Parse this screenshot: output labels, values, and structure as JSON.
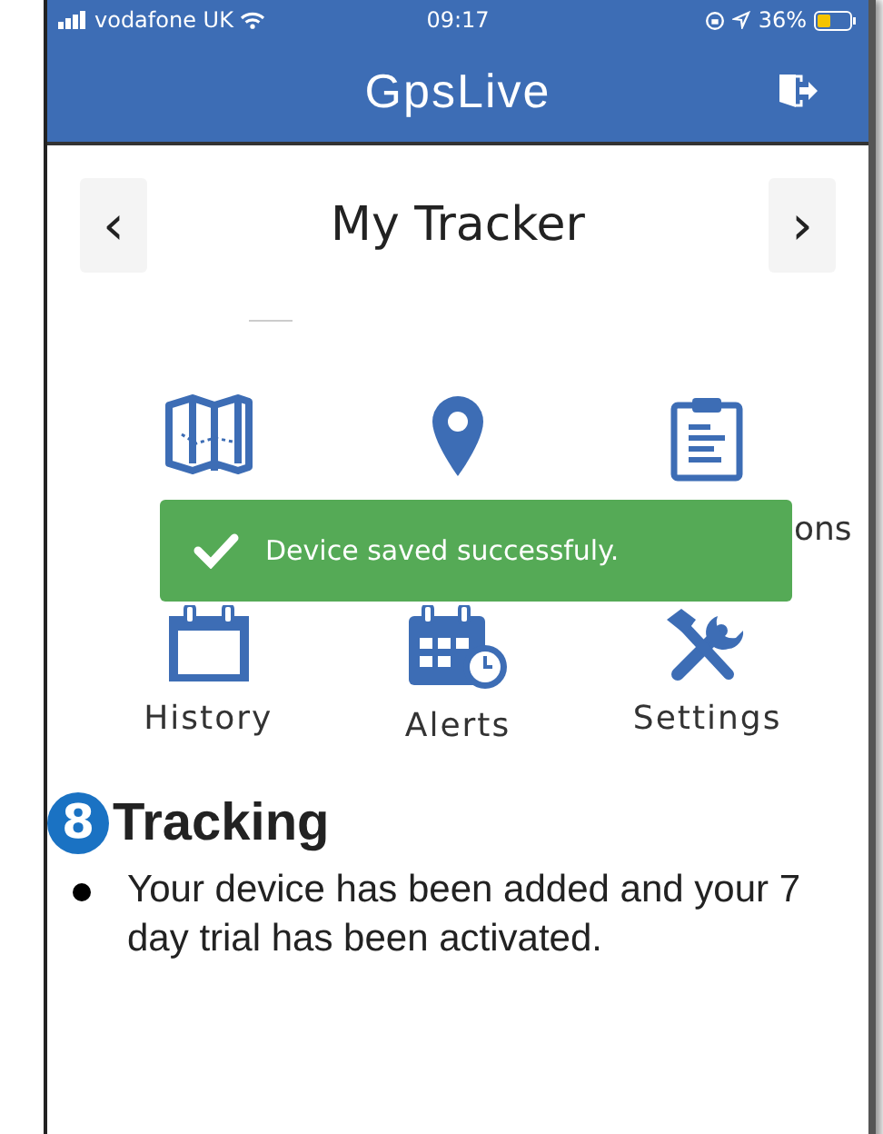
{
  "status_bar": {
    "carrier": "vodafone UK",
    "time": "09:17",
    "battery_percent": "36%"
  },
  "header": {
    "logo": "GpsLive"
  },
  "tracker": {
    "prev": "‹",
    "title": "My Tracker",
    "next": "›"
  },
  "menu_top": [
    {
      "kind": "map"
    },
    {
      "kind": "pin"
    },
    {
      "kind": "clipboard"
    }
  ],
  "toast": {
    "message": "Device saved successfuly.",
    "trailing_visible_text": "ons"
  },
  "menu_bottom": [
    {
      "kind": "calendar",
      "label": "History"
    },
    {
      "kind": "calendar-clock",
      "label": "Alerts"
    },
    {
      "kind": "tools",
      "label": "Settings"
    }
  ],
  "instruction": {
    "step": "8",
    "heading": "Tracking",
    "bullets": [
      "Your device has been added and your 7 day trial has been activated."
    ]
  }
}
